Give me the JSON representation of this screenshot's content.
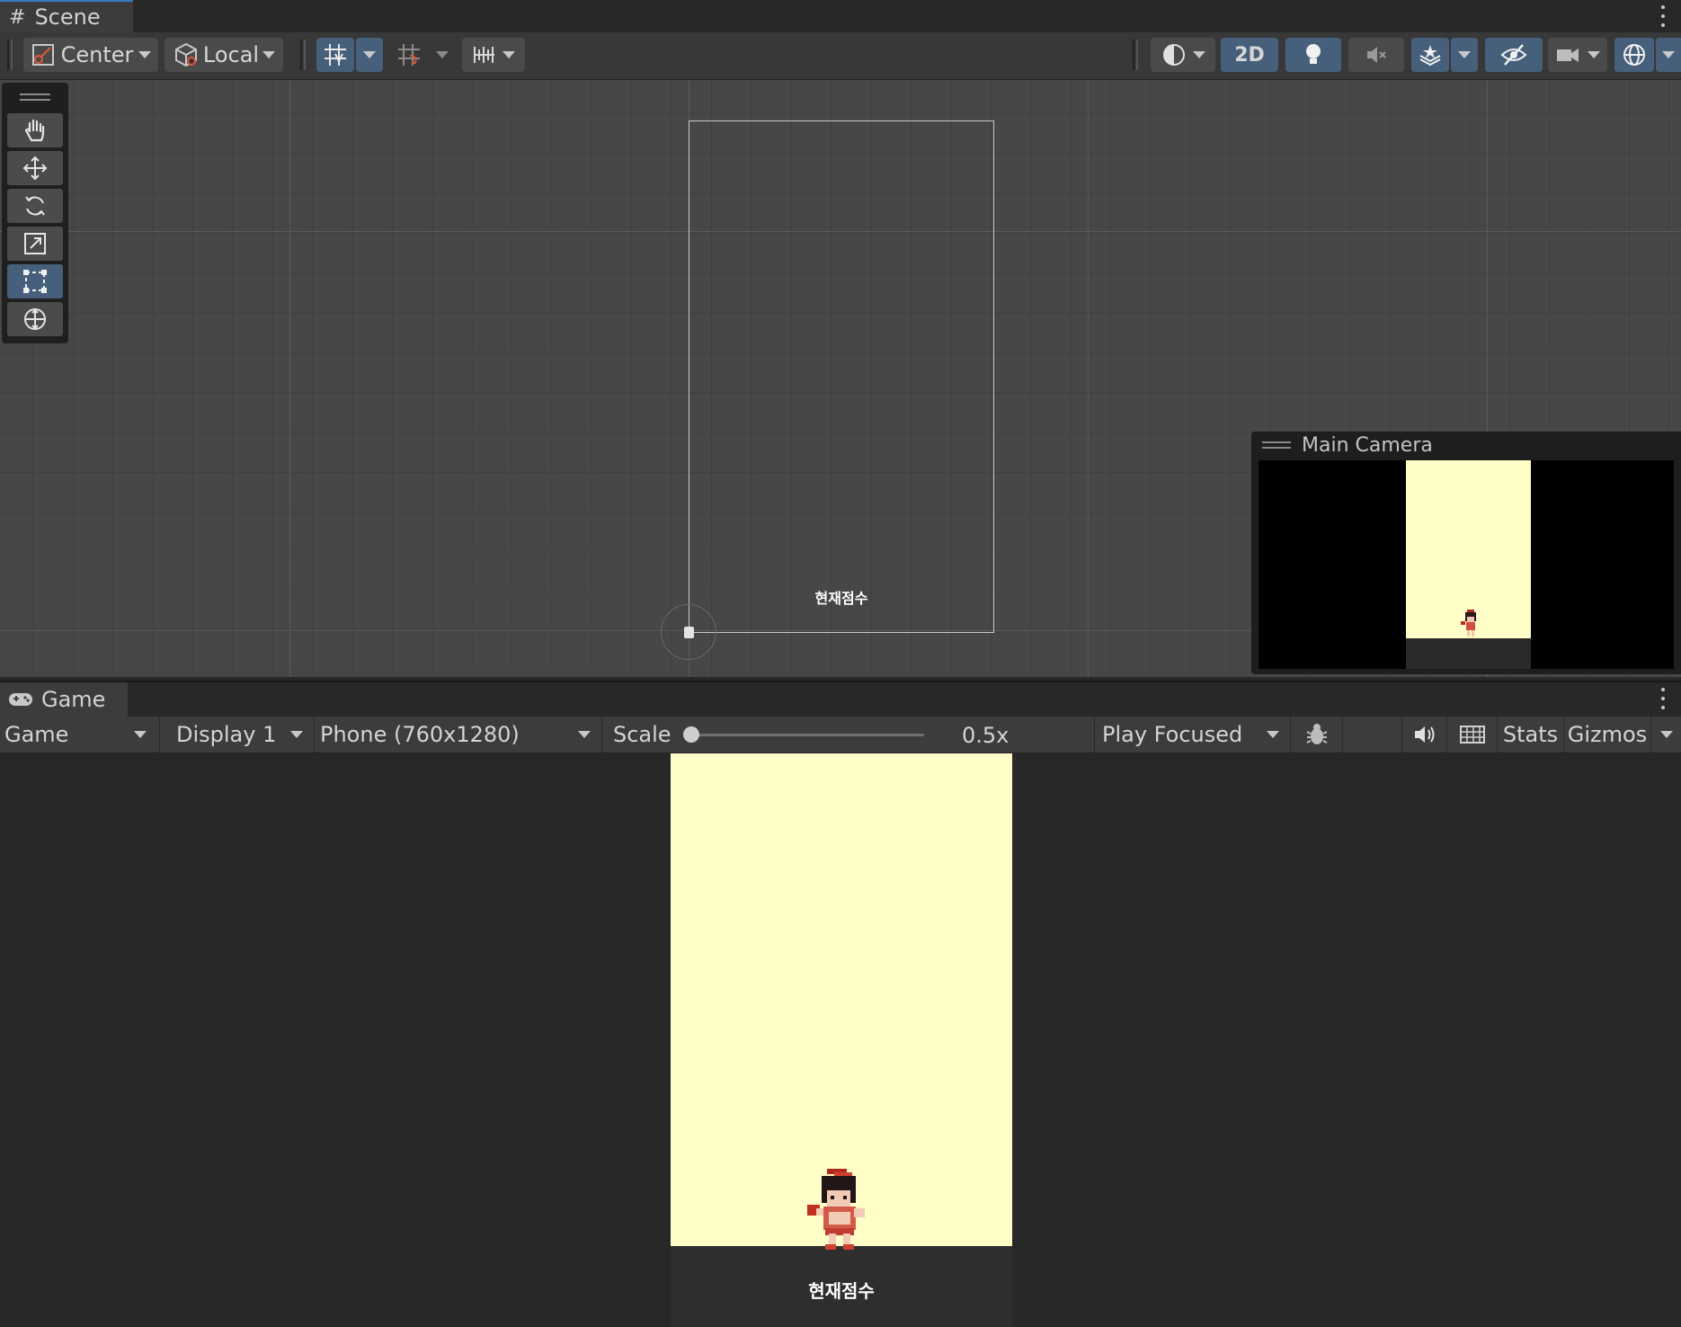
{
  "scene_tab": {
    "title": "Scene"
  },
  "scene_toolbar": {
    "pivot_mode": "Center",
    "pivot_rotation": "Local",
    "mode_2d": "2D"
  },
  "scene_view": {
    "ui_text": "현재점수",
    "camera_preview_title": "Main Camera"
  },
  "game_tab": {
    "title": "Game"
  },
  "game_toolbar": {
    "view_select": "Game",
    "display_select": "Display 1",
    "resolution_select": "Phone (760x1280)",
    "scale_label": "Scale",
    "scale_value": "0.5x",
    "play_mode_select": "Play Focused",
    "stats_label": "Stats",
    "gizmos_label": "Gizmos"
  },
  "game_view": {
    "score_text": "현재점수"
  },
  "colors": {
    "accent_active": "#46607c",
    "game_background": "#fffdc8",
    "editor_dark": "#282828"
  }
}
